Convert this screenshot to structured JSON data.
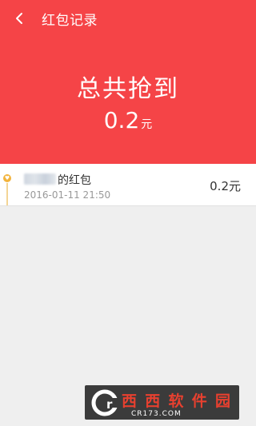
{
  "header": {
    "title": "红包记录",
    "total_label": "总共抢到",
    "total_amount": "0.2",
    "total_unit": "元"
  },
  "records": [
    {
      "sender_suffix": "的红包",
      "time": "2016-01-11 21:50",
      "amount": "0.2元"
    }
  ],
  "watermark": {
    "brand": "西西软件园",
    "url": "CR173.COM"
  },
  "colors": {
    "header_bg": "#f54447",
    "page_bg": "#efefef",
    "medal": "#f2b33c"
  }
}
